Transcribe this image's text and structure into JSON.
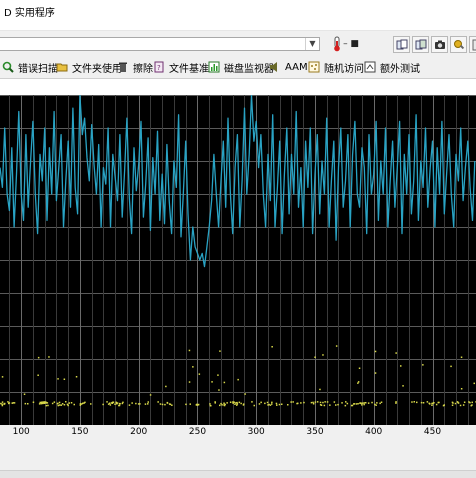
{
  "window": {
    "title": "D 实用程序"
  },
  "tabs": [
    {
      "label": "错误扫描",
      "icon": "magnifier-icon"
    },
    {
      "label": "文件夹使用",
      "icon": "folder-icon"
    },
    {
      "label": "擦除",
      "icon": "trash-icon"
    },
    {
      "label": "文件基准",
      "icon": "file-benchmark-icon"
    },
    {
      "label": "磁盘监视器",
      "icon": "disk-monitor-icon"
    },
    {
      "label": "AAM",
      "icon": "speaker-icon"
    },
    {
      "label": "随机访问",
      "icon": "random-access-icon"
    },
    {
      "label": "额外测试",
      "icon": "extra-tests-icon"
    }
  ],
  "chart_data": {
    "type": "line",
    "x_ticks": [
      100,
      150,
      200,
      250,
      300,
      350,
      400,
      450
    ],
    "xlim": [
      82,
      487
    ],
    "ylim": [
      0,
      100
    ],
    "grid": true,
    "line_color": "#29a3c4",
    "series": [
      {
        "x": [
          82,
          84,
          86,
          88,
          90,
          92,
          94,
          96,
          98,
          100,
          102,
          104,
          106,
          108,
          110,
          112,
          114,
          116,
          118,
          120,
          122,
          124,
          126,
          128,
          130,
          132,
          134,
          136,
          138,
          140,
          142,
          144,
          146,
          148,
          150,
          152,
          154,
          156,
          158,
          160,
          162,
          164,
          166,
          168,
          170,
          172,
          174,
          176,
          178,
          180,
          182,
          184,
          186,
          188,
          190,
          192,
          194,
          196,
          198,
          200,
          202,
          204,
          206,
          208,
          210,
          212,
          214,
          216,
          218,
          220,
          222,
          224,
          226,
          228,
          230,
          232,
          234,
          236,
          238,
          240,
          242,
          244,
          246,
          248,
          250,
          252,
          254,
          256,
          258,
          260,
          262,
          264,
          266,
          268,
          270,
          272,
          274,
          276,
          278,
          280,
          282,
          284,
          286,
          288,
          290,
          292,
          294,
          296,
          298,
          300,
          302,
          304,
          306,
          308,
          310,
          312,
          314,
          316,
          318,
          320,
          322,
          324,
          326,
          328,
          330,
          332,
          334,
          336,
          338,
          340,
          342,
          344,
          346,
          348,
          350,
          352,
          354,
          356,
          358,
          360,
          362,
          364,
          366,
          368,
          370,
          372,
          374,
          376,
          378,
          380,
          382,
          384,
          386,
          388,
          390,
          392,
          394,
          396,
          398,
          400,
          402,
          404,
          406,
          408,
          410,
          412,
          414,
          416,
          418,
          420,
          422,
          424,
          426,
          428,
          430,
          432,
          434,
          436,
          438,
          440,
          442,
          444,
          446,
          448,
          450,
          452,
          454,
          456,
          458,
          460,
          462,
          464,
          466,
          468,
          470,
          472,
          474,
          476,
          478,
          480,
          482,
          484,
          486
        ],
        "y": [
          78,
          72,
          90,
          70,
          65,
          84,
          60,
          76,
          95,
          70,
          62,
          88,
          66,
          80,
          92,
          70,
          58,
          82,
          74,
          90,
          62,
          84,
          70,
          95,
          68,
          78,
          88,
          60,
          74,
          86,
          66,
          96,
          72,
          64,
          100,
          88,
          93,
          81,
          74,
          91,
          79,
          70,
          85,
          60,
          78,
          73,
          90,
          60,
          82,
          75,
          68,
          88,
          63,
          77,
          93,
          69,
          58,
          84,
          71,
          79,
          92,
          63,
          73,
          87,
          59,
          81,
          70,
          89,
          62,
          76,
          61,
          85,
          68,
          58,
          80,
          72,
          94,
          57,
          70,
          86,
          64,
          50,
          60,
          54,
          52,
          50,
          52,
          48,
          54,
          60,
          68,
          82,
          70,
          60,
          74,
          86,
          66,
          93,
          70,
          58,
          78,
          88,
          60,
          74,
          96,
          70,
          82,
          100,
          86,
          92,
          78,
          88,
          70,
          60,
          82,
          68,
          94,
          60,
          72,
          86,
          58,
          76,
          90,
          64,
          82,
          70,
          95,
          66,
          78,
          60,
          86,
          72,
          90,
          58,
          76,
          88,
          64,
          80,
          70,
          93,
          60,
          74,
          86,
          56,
          78,
          90,
          66,
          74,
          88,
          60,
          82,
          92,
          70,
          66,
          84,
          78,
          58,
          88,
          70,
          76,
          92,
          62,
          80,
          70,
          90,
          60,
          74,
          86,
          66,
          78,
          92,
          58,
          82,
          70,
          88,
          64,
          74,
          94,
          62,
          80,
          72,
          90,
          66,
          78,
          86,
          60,
          84,
          70,
          92,
          64,
          76,
          88,
          70,
          60,
          82,
          74,
          90,
          68,
          78,
          86,
          72,
          62,
          80
        ]
      }
    ],
    "scatter_color": "#d8d84a"
  }
}
